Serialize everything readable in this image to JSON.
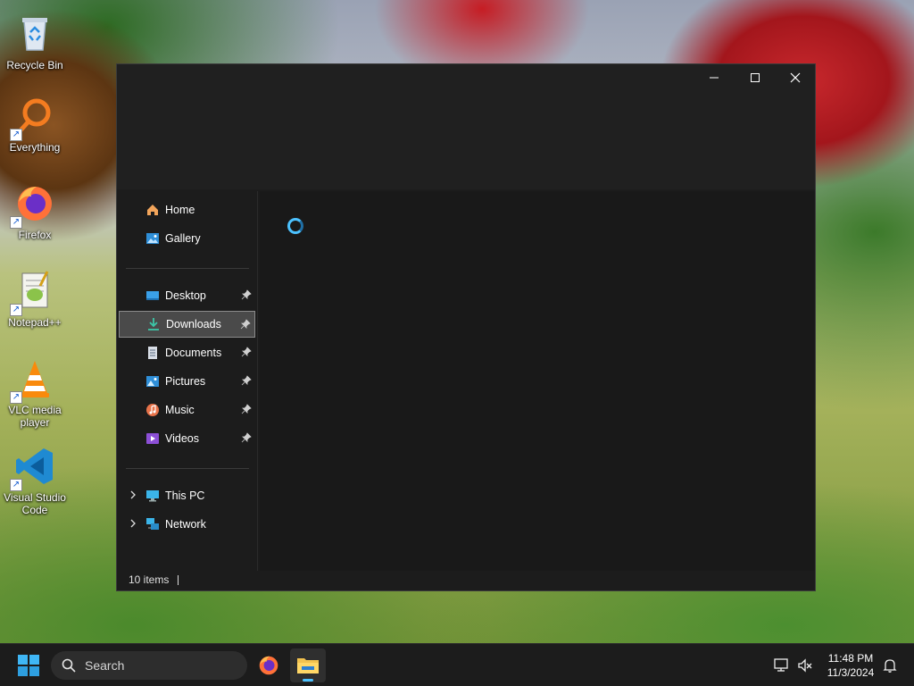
{
  "desktop": {
    "icons": [
      {
        "label": "Recycle Bin",
        "icon": "recycle-bin-icon"
      },
      {
        "label": "Everything",
        "icon": "everything-search-icon"
      },
      {
        "label": "Firefox",
        "icon": "firefox-icon"
      },
      {
        "label": "Notepad++",
        "icon": "notepad-plus-plus-icon"
      },
      {
        "label": "VLC media player",
        "icon": "vlc-icon"
      },
      {
        "label": "Visual Studio Code",
        "icon": "vscode-icon"
      }
    ]
  },
  "window": {
    "caption": {
      "minimize": "—",
      "maximize": "☐",
      "close": "✕"
    },
    "nav": {
      "quick": [
        {
          "label": "Home",
          "icon": "home-icon"
        },
        {
          "label": "Gallery",
          "icon": "gallery-icon"
        }
      ],
      "pinned": [
        {
          "label": "Desktop",
          "icon": "desktop-folder-icon"
        },
        {
          "label": "Downloads",
          "icon": "downloads-folder-icon",
          "selected": true
        },
        {
          "label": "Documents",
          "icon": "documents-folder-icon"
        },
        {
          "label": "Pictures",
          "icon": "pictures-folder-icon"
        },
        {
          "label": "Music",
          "icon": "music-folder-icon"
        },
        {
          "label": "Videos",
          "icon": "videos-folder-icon"
        }
      ],
      "locations": [
        {
          "label": "This PC",
          "icon": "this-pc-icon"
        },
        {
          "label": "Network",
          "icon": "network-icon"
        }
      ]
    },
    "status": {
      "item_count": "10 items"
    }
  },
  "taskbar": {
    "search_placeholder": "Search",
    "apps": [
      {
        "name": "Firefox",
        "icon": "firefox-icon",
        "active": false
      },
      {
        "name": "File Explorer",
        "icon": "file-explorer-icon",
        "active": true
      }
    ],
    "clock": {
      "time": "11:48 PM",
      "date": "11/3/2024"
    }
  },
  "colors": {
    "accent": "#4cc2ff",
    "window_bg": "#1c1c1c",
    "taskbar_bg": "#1c1c1c"
  }
}
